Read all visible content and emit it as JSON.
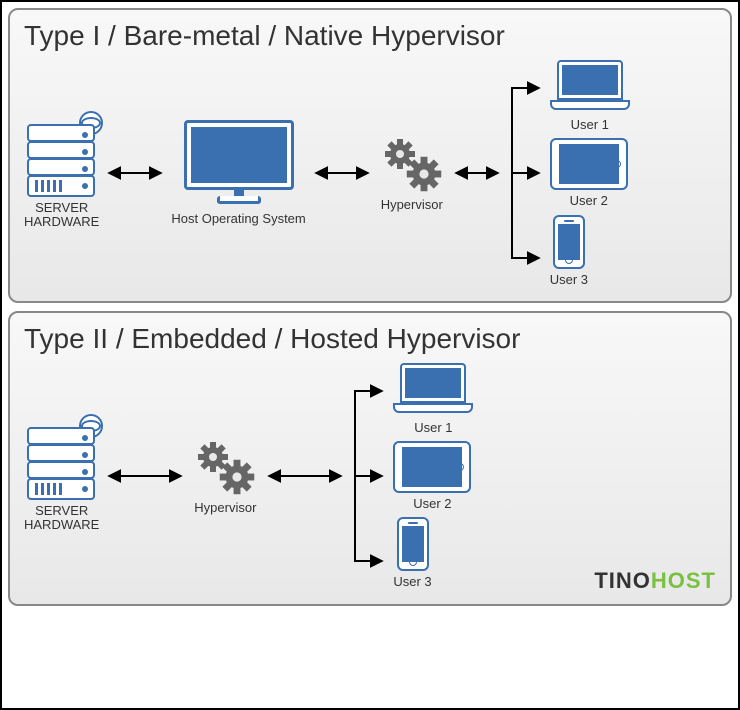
{
  "panels": {
    "type1": {
      "title": "Type I / Bare-metal / Native Hypervisor",
      "server_label": "SERVER\nHARDWARE",
      "host_os_label": "Host Operating System",
      "hypervisor_label": "Hypervisor",
      "user1_label": "User 1",
      "user2_label": "User 2",
      "user3_label": "User 3"
    },
    "type2": {
      "title": "Type II / Embedded / Hosted Hypervisor",
      "server_label": "SERVER\nHARDWARE",
      "hypervisor_label": "Hypervisor",
      "user1_label": "User 1",
      "user2_label": "User 2",
      "user3_label": "User 3"
    }
  },
  "brand": {
    "part1": "TINO",
    "part2": "HOST"
  },
  "colors": {
    "accent": "#3a6fb0",
    "gear": "#666",
    "arrow": "#000",
    "brand_green": "#7ac142"
  }
}
